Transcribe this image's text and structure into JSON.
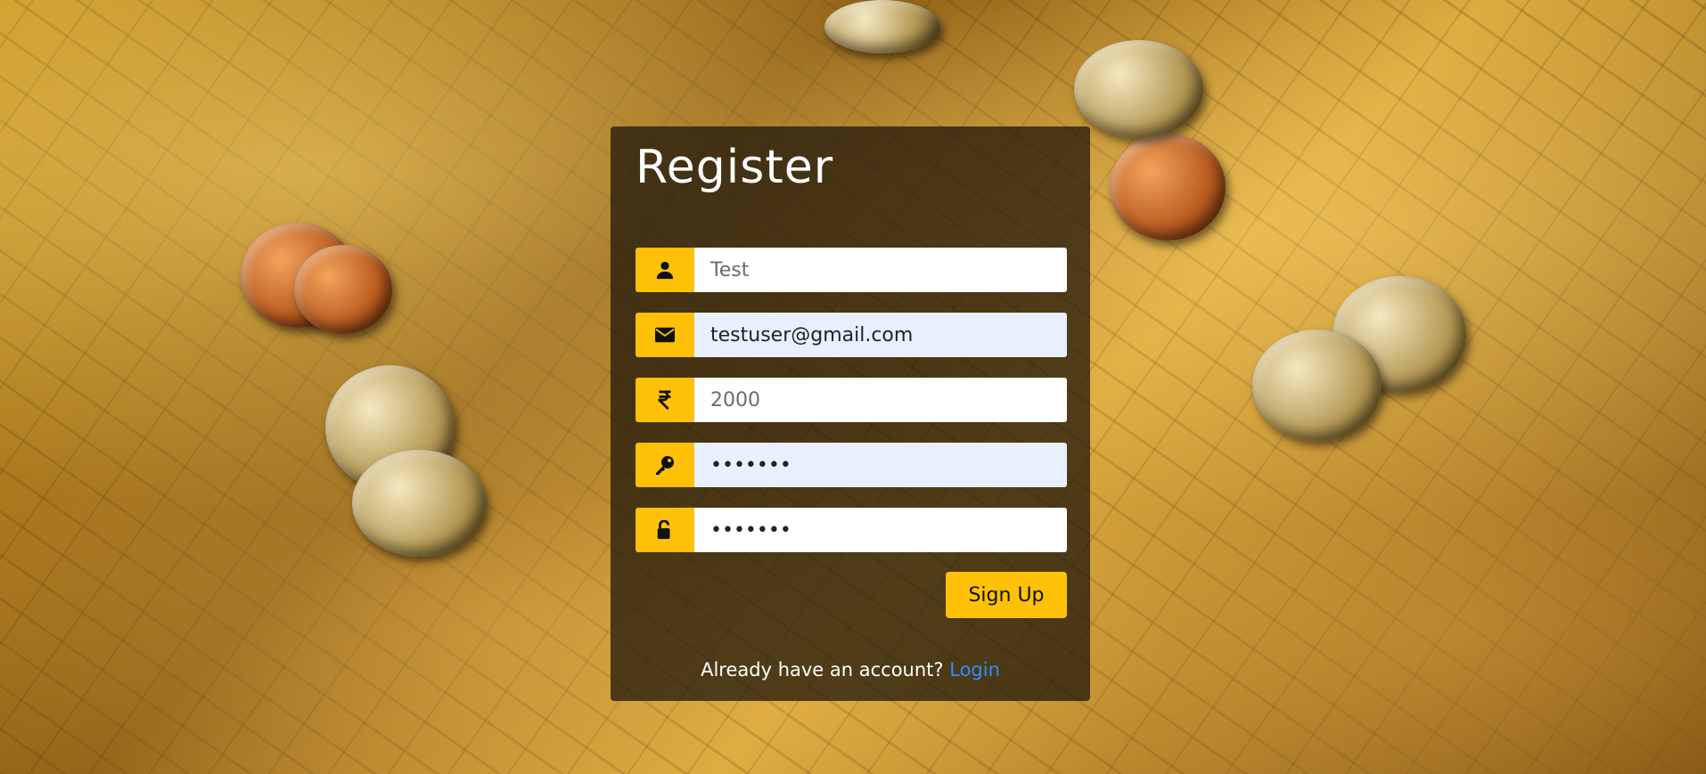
{
  "form": {
    "title": "Register",
    "fields": [
      {
        "name": "name",
        "value": "Test",
        "icon": "user-icon"
      },
      {
        "name": "email",
        "value": "testuser@gmail.com",
        "icon": "envelope-icon"
      },
      {
        "name": "amount",
        "value": "2000",
        "icon": "rupee-icon"
      },
      {
        "name": "password",
        "value": "•••••••",
        "icon": "key-icon"
      },
      {
        "name": "confirm-password",
        "value": "•••••••",
        "icon": "unlock-icon"
      }
    ],
    "submit_label": "Sign Up",
    "footer_text": "Already have an account?",
    "login_link": "Login"
  },
  "colors": {
    "accent": "#ffc107",
    "link": "#2f8cff",
    "panel": "#19120b",
    "autofill": "#e8f0fe"
  }
}
